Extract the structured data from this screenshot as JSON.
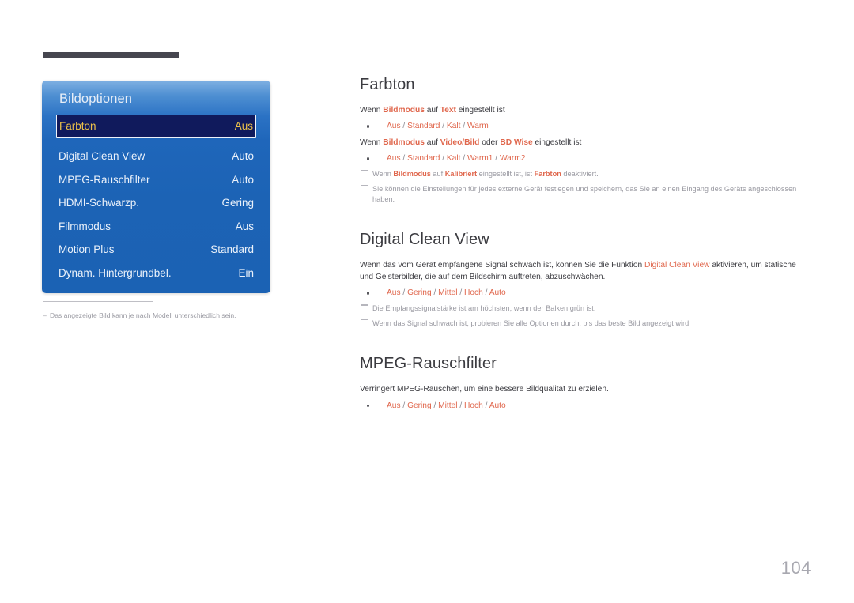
{
  "page": {
    "number": "104",
    "accent_color": "#e0674d",
    "rule_color": "#46464f"
  },
  "osd": {
    "title": "Bildoptionen",
    "rows": [
      {
        "label": "Farbton",
        "value": "Aus",
        "selected": true
      },
      {
        "label": "Digital Clean View",
        "value": "Auto",
        "selected": false
      },
      {
        "label": "MPEG-Rauschfilter",
        "value": "Auto",
        "selected": false
      },
      {
        "label": "HDMI-Schwarzp.",
        "value": "Gering",
        "selected": false
      },
      {
        "label": "Filmmodus",
        "value": "Aus",
        "selected": false
      },
      {
        "label": "Motion Plus",
        "value": "Standard",
        "selected": false
      },
      {
        "label": "Dynam. Hintergrundbel.",
        "value": "Ein",
        "selected": false
      }
    ],
    "footnote_dash": "–",
    "footnote": "Das angezeigte Bild kann je nach Modell unterschiedlich sein."
  },
  "sections": {
    "farbton": {
      "title": "Farbton",
      "para1_a": "Wenn ",
      "para1_b": "Bildmodus",
      "para1_c": " auf ",
      "para1_d": "Text",
      "para1_e": " eingestellt ist",
      "options1": [
        "Aus",
        "Standard",
        "Kalt",
        "Warm"
      ],
      "para2_a": "Wenn ",
      "para2_b": "Bildmodus",
      "para2_c": " auf ",
      "para2_d": "Video/Bild",
      "para2_e": " oder ",
      "para2_f": "BD Wise",
      "para2_g": " eingestellt ist",
      "options2": [
        "Aus",
        "Standard",
        "Kalt",
        "Warm1",
        "Warm2"
      ],
      "note1_a": "Wenn ",
      "note1_b": "Bildmodus",
      "note1_c": " auf ",
      "note1_d": "Kalibriert",
      "note1_e": " eingestellt ist, ist ",
      "note1_f": "Farbton",
      "note1_g": " deaktiviert.",
      "note2": "Sie können die Einstellungen für jedes externe Gerät festlegen und speichern, das Sie an einen Eingang des Geräts angeschlossen haben."
    },
    "digital_clean_view": {
      "title": "Digital Clean View",
      "para_a": "Wenn das vom Gerät empfangene Signal schwach ist, können Sie die Funktion ",
      "para_b": "Digital Clean View",
      "para_c": " aktivieren, um statische und Geisterbilder, die auf dem Bildschirm auftreten, abzuschwächen.",
      "options": [
        "Aus",
        "Gering",
        "Mittel",
        "Hoch",
        "Auto"
      ],
      "note1": "Die Empfangssignalstärke ist am höchsten, wenn der Balken grün ist.",
      "note2": "Wenn das Signal schwach ist, probieren Sie alle Optionen durch, bis das beste Bild angezeigt wird."
    },
    "mpeg": {
      "title": "MPEG-Rauschfilter",
      "para": "Verringert MPEG-Rauschen, um eine bessere Bildqualität zu erzielen.",
      "options": [
        "Aus",
        "Gering",
        "Mittel",
        "Hoch",
        "Auto"
      ]
    }
  }
}
